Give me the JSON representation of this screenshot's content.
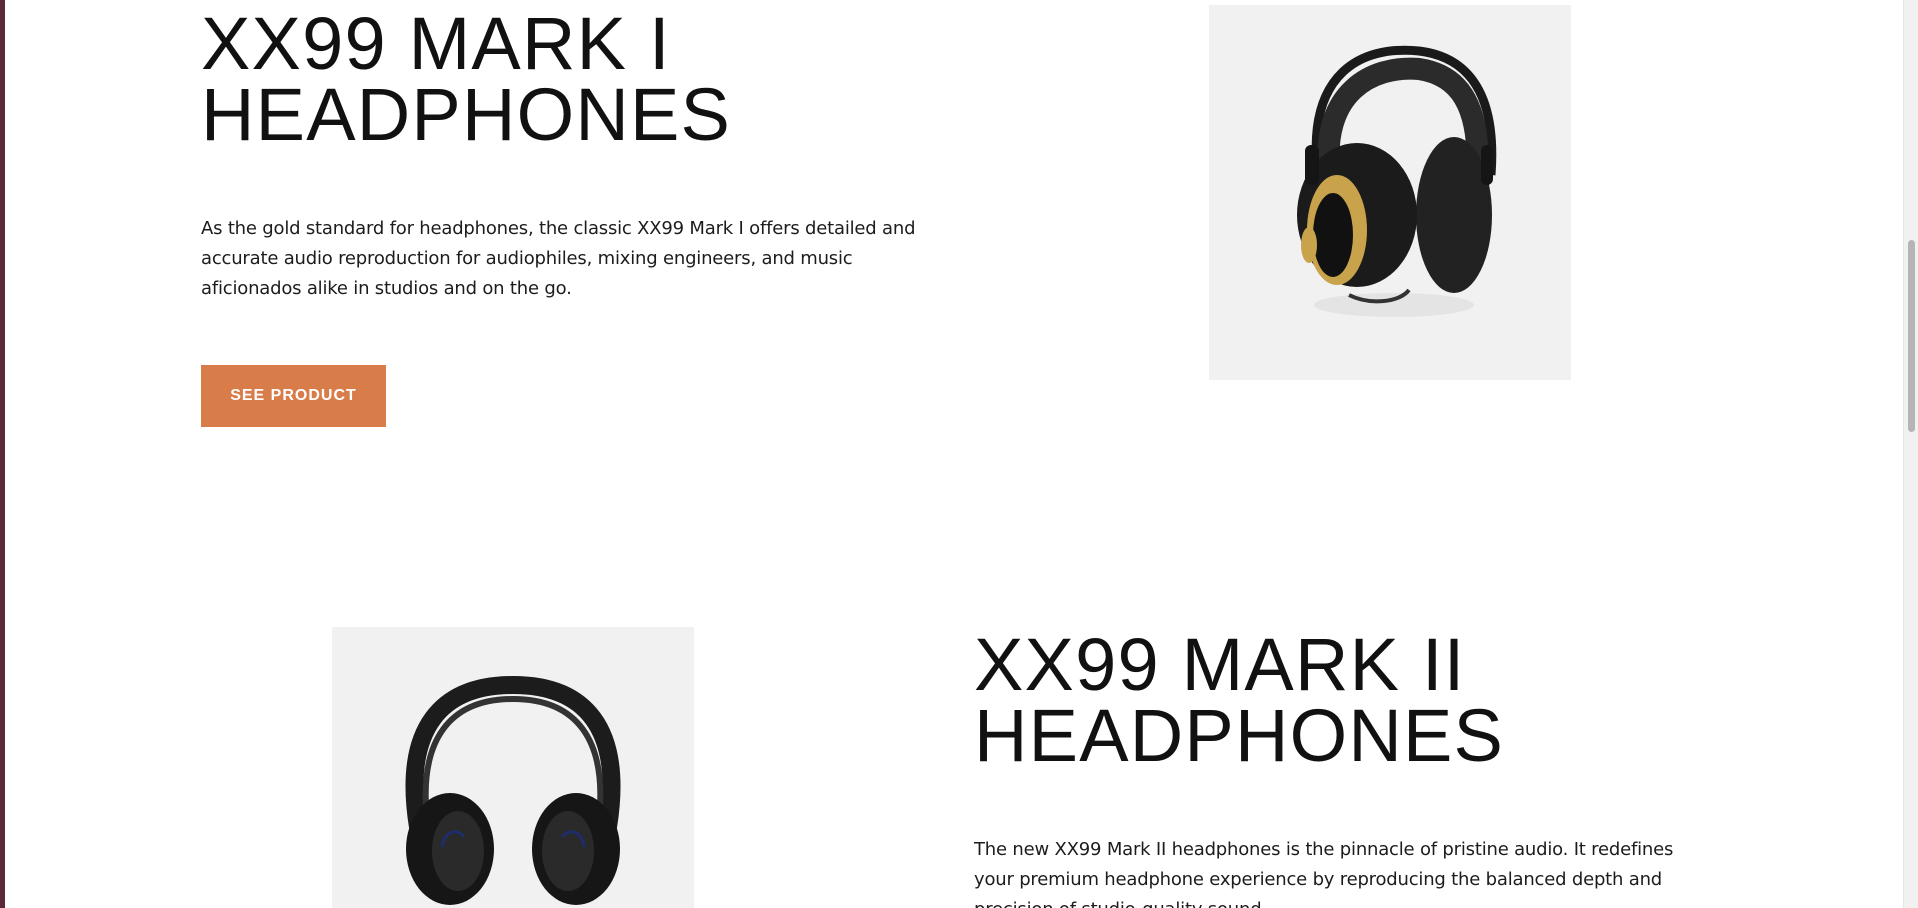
{
  "products": [
    {
      "title": "XX99 MARK I\nHEADPHONES",
      "description": "As the gold standard for headphones, the classic XX99 Mark I offers detailed and accurate audio reproduction for audiophiles, mixing engineers, and music aficionados alike in studios and on the go.",
      "button_label": "SEE PRODUCT"
    },
    {
      "title": "XX99 MARK II\nHEADPHONES",
      "description": "The new XX99 Mark II headphones is the pinnacle of pristine audio. It redefines your premium headphone experience by reproducing the balanced depth and precision of studio-quality sound."
    }
  ],
  "colors": {
    "accent": "#d87d4a",
    "image_bg": "#f1f1f1",
    "text": "#111111",
    "left_edge": "#5a2a3c"
  },
  "icons": {
    "product_1_image": "over-ear-studio-headphones",
    "product_2_image": "wireless-headphones"
  }
}
